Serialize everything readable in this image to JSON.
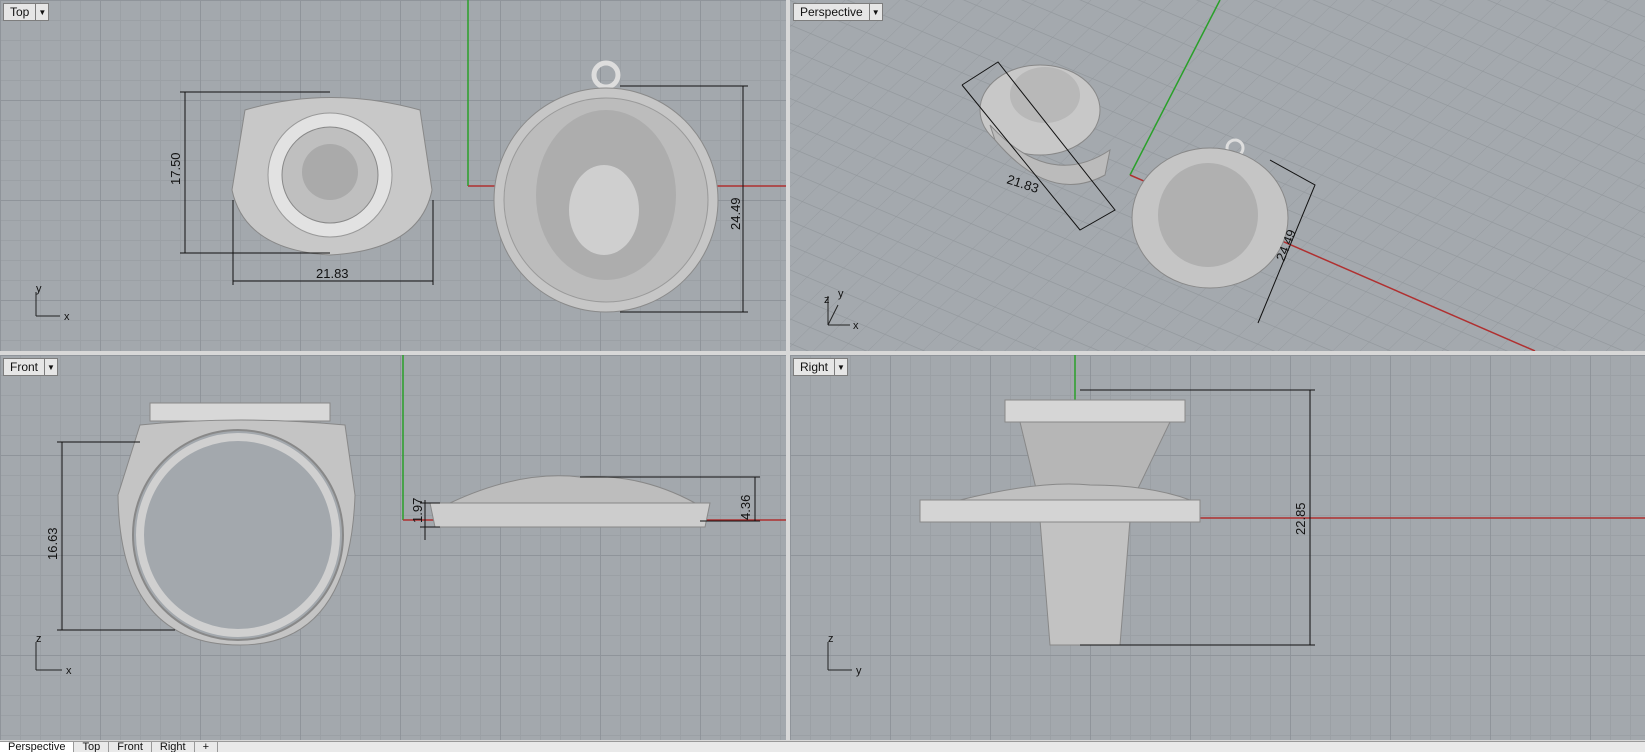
{
  "viewports": {
    "top": {
      "label": "Top",
      "dims": {
        "ring_height": "17.50",
        "ring_width": "21.83",
        "pendant_height": "24.49"
      },
      "axes": {
        "a": "y",
        "b": "x"
      }
    },
    "perspective": {
      "label": "Perspective",
      "dims": {
        "ring_width": "21.83",
        "pendant_height": "24.49"
      },
      "axes": {
        "a": "y",
        "b": "x",
        "c": "z"
      }
    },
    "front": {
      "label": "Front",
      "dims": {
        "ring_height": "16.63",
        "pendant_thin": "1.97",
        "pendant_thick": "4.36"
      },
      "axes": {
        "a": "z",
        "b": "x"
      }
    },
    "right": {
      "label": "Right",
      "dims": {
        "ring_total": "22.85"
      },
      "axes": {
        "a": "z",
        "b": "y"
      }
    }
  },
  "tabs": [
    "Perspective",
    "Top",
    "Front",
    "Right"
  ],
  "tab_add": "+",
  "icons": {
    "dropdown": "dropdown-arrow-icon",
    "add": "add-tab-icon"
  },
  "colors": {
    "x_axis": "#b03030",
    "y_axis": "#2aa02a",
    "model": "#cfcfcf",
    "background": "#a3a8ad"
  }
}
